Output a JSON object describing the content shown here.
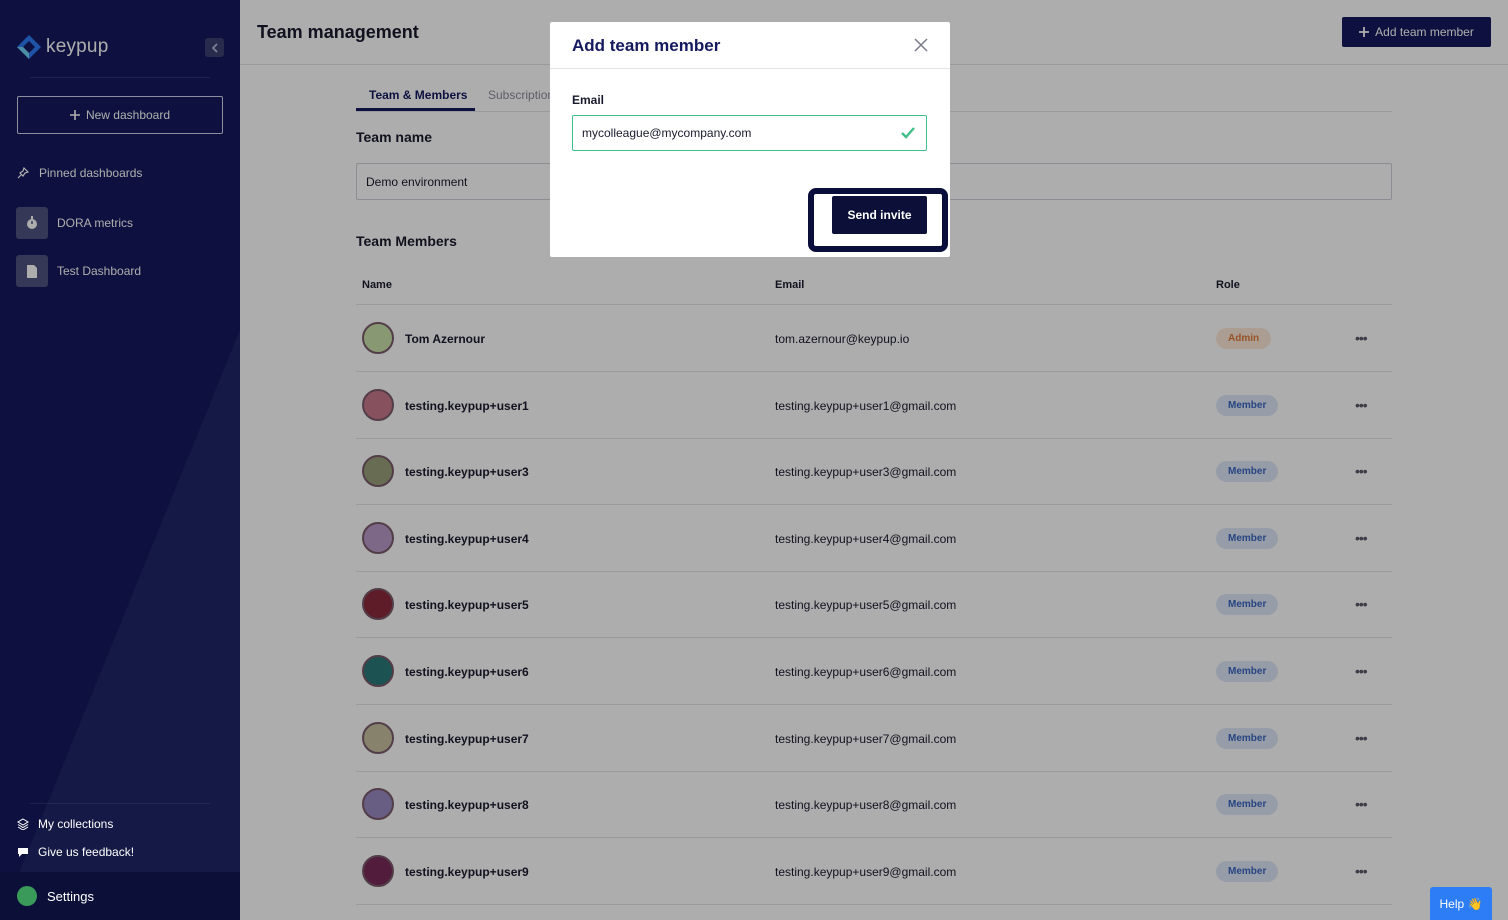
{
  "sidebar": {
    "logo_text": "keypup",
    "new_dashboard_label": "New dashboard",
    "pinned_label": "Pinned dashboards",
    "dashboards": [
      {
        "label": "DORA metrics",
        "icon": "stopwatch-icon"
      },
      {
        "label": "Test Dashboard",
        "icon": "document-icon"
      }
    ],
    "collections_label": "My collections",
    "feedback_label": "Give us feedback!",
    "settings_label": "Settings"
  },
  "header": {
    "title": "Team management",
    "add_member_label": "Add team member"
  },
  "tabs": [
    {
      "label": "Team & Members",
      "active": true
    },
    {
      "label": "Subscription",
      "active": false
    }
  ],
  "team_name": {
    "heading": "Team name",
    "value": "Demo environment"
  },
  "members": {
    "heading": "Team Members",
    "columns": [
      "Name",
      "Email",
      "Role"
    ],
    "rows": [
      {
        "name": "Tom Azernour",
        "email": "tom.azernour@keypup.io",
        "role": "Admin",
        "avatar_color": "#c8e0a8"
      },
      {
        "name": "testing.keypup+user1",
        "email": "testing.keypup+user1@gmail.com",
        "role": "Member",
        "avatar_color": "#c87a8a"
      },
      {
        "name": "testing.keypup+user3",
        "email": "testing.keypup+user3@gmail.com",
        "role": "Member",
        "avatar_color": "#9aa07a"
      },
      {
        "name": "testing.keypup+user4",
        "email": "testing.keypup+user4@gmail.com",
        "role": "Member",
        "avatar_color": "#b89ac8"
      },
      {
        "name": "testing.keypup+user5",
        "email": "testing.keypup+user5@gmail.com",
        "role": "Member",
        "avatar_color": "#8a2a3a"
      },
      {
        "name": "testing.keypup+user6",
        "email": "testing.keypup+user6@gmail.com",
        "role": "Member",
        "avatar_color": "#2a7a7a"
      },
      {
        "name": "testing.keypup+user7",
        "email": "testing.keypup+user7@gmail.com",
        "role": "Member",
        "avatar_color": "#c8c0a0"
      },
      {
        "name": "testing.keypup+user8",
        "email": "testing.keypup+user8@gmail.com",
        "role": "Member",
        "avatar_color": "#9a8ac0"
      },
      {
        "name": "testing.keypup+user9",
        "email": "testing.keypup+user9@gmail.com",
        "role": "Member",
        "avatar_color": "#7a2a5a"
      }
    ]
  },
  "modal": {
    "title": "Add team member",
    "email_label": "Email",
    "email_value": "mycolleague@mycompany.com",
    "send_label": "Send invite"
  },
  "help_label": "Help 👋",
  "colors": {
    "sidebar_bg": "#151a5e",
    "primary": "#151a5e",
    "success": "#3fbf8a",
    "admin_badge": "#e07a3a",
    "member_badge": "#3a66c0",
    "help": "#2d7df6"
  }
}
